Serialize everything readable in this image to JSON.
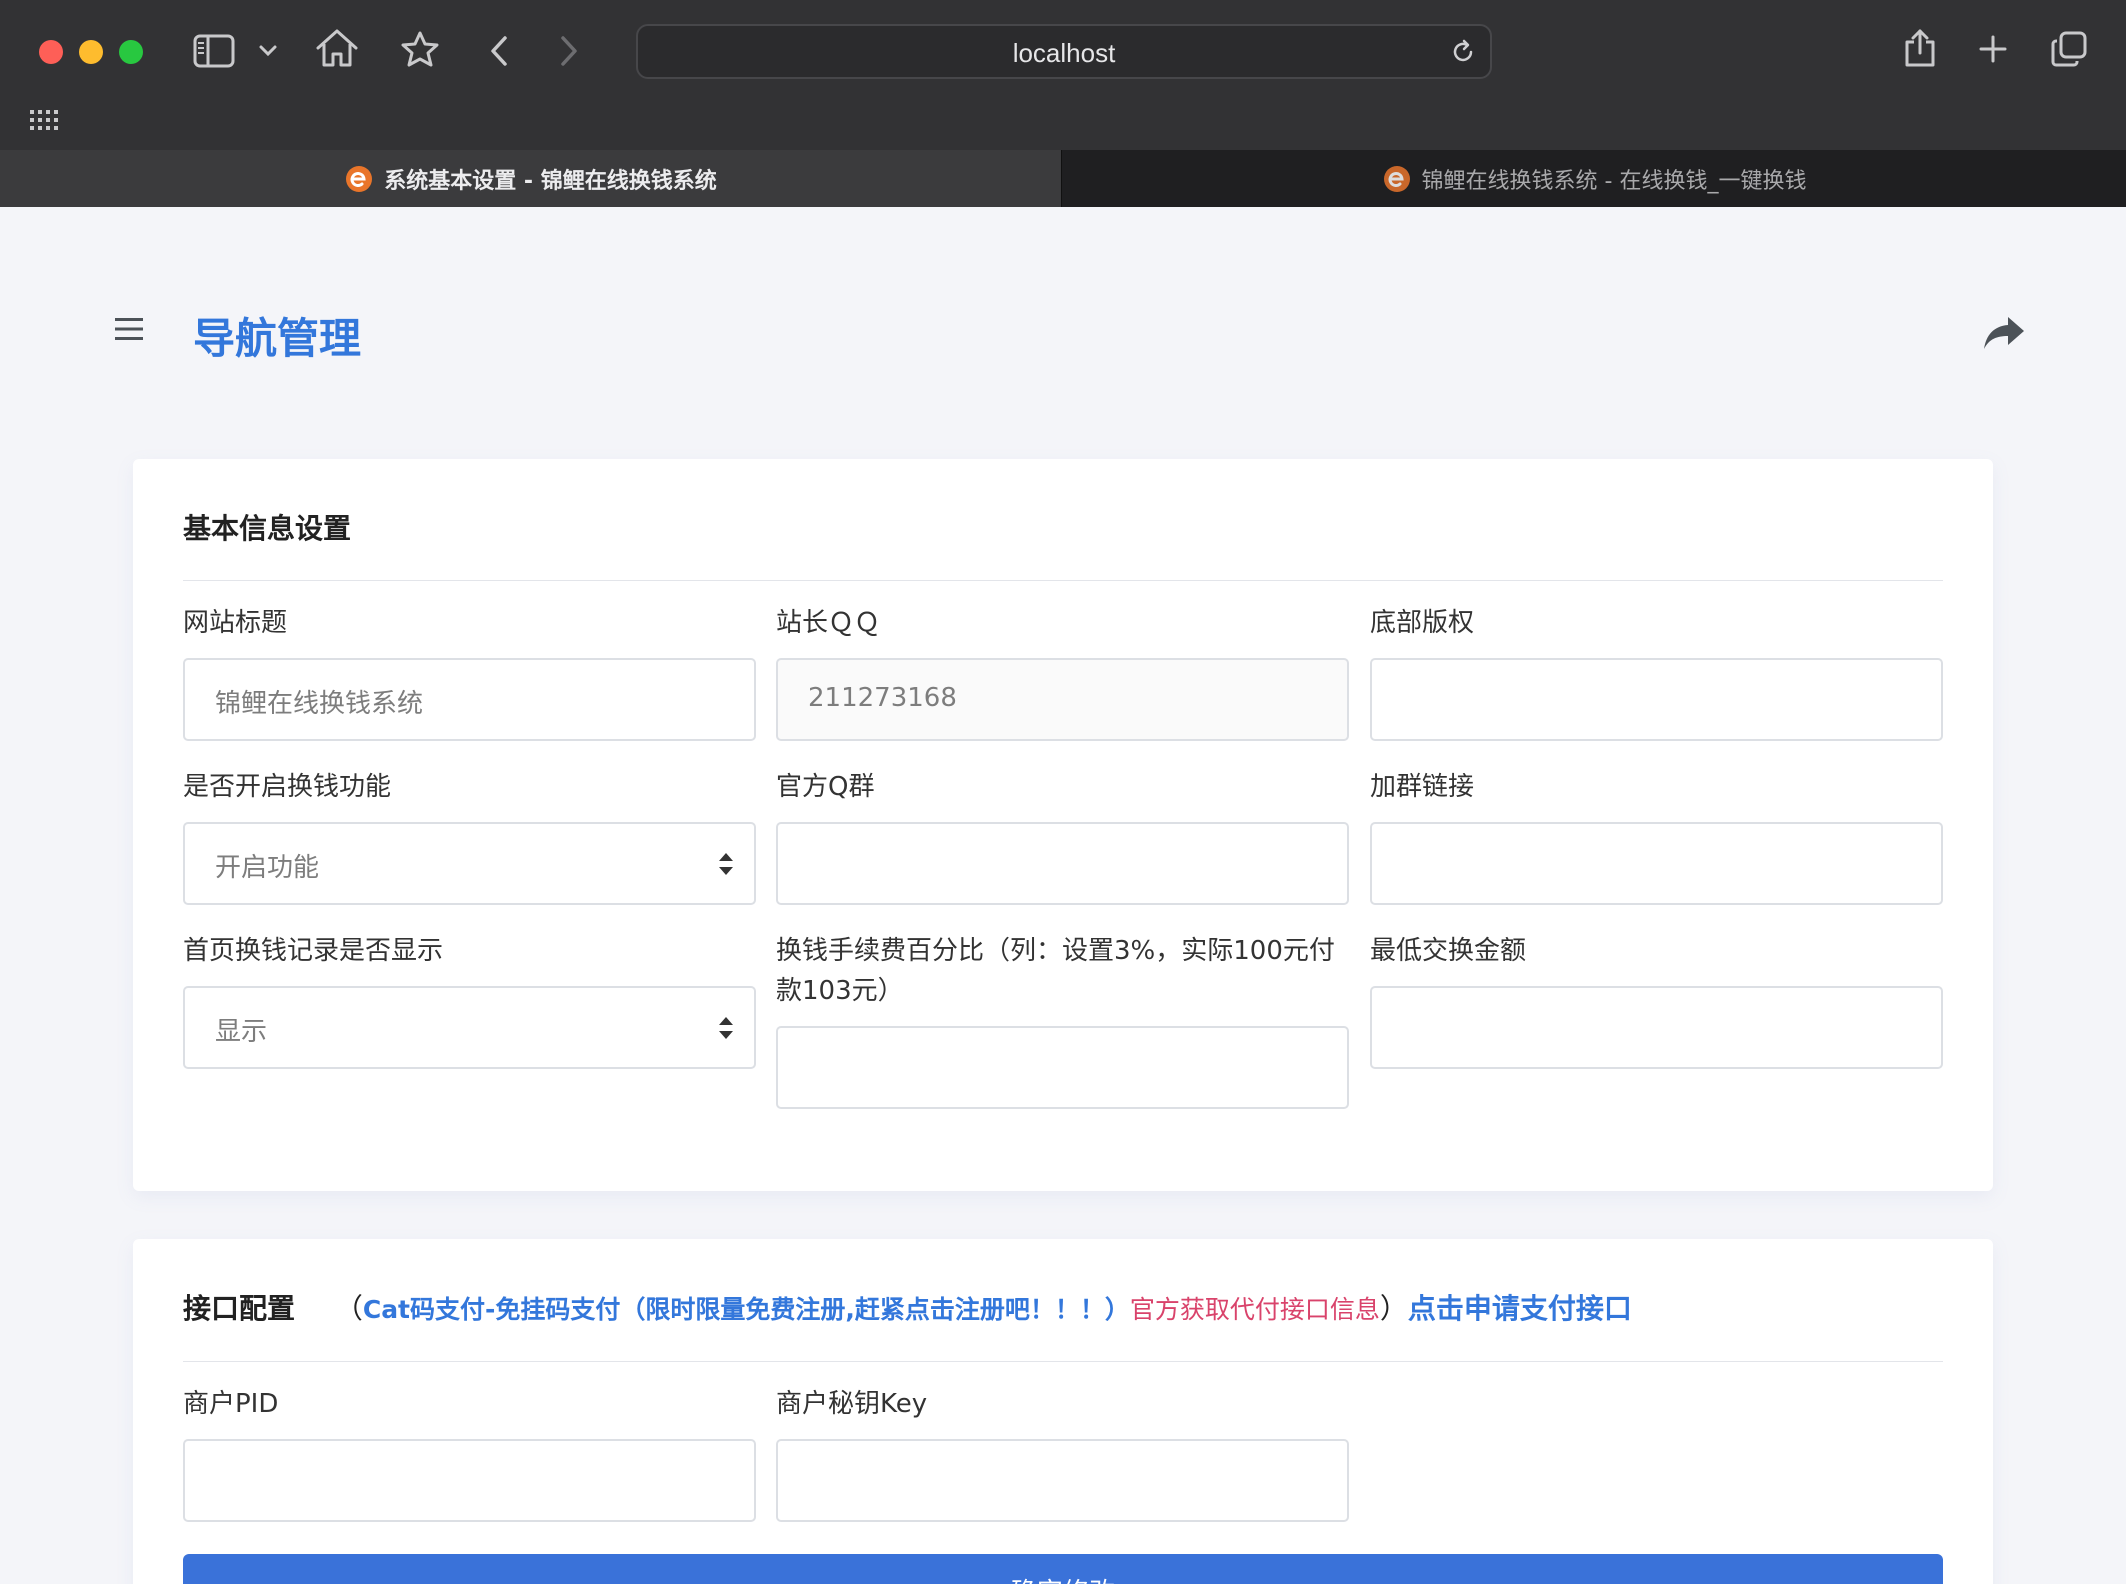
{
  "browser": {
    "address": "localhost",
    "tabs": [
      {
        "label": "系统基本设置 - 锦鲤在线换钱系统"
      },
      {
        "label": "锦鲤在线换钱系统 - 在线换钱_一键换钱"
      }
    ]
  },
  "page": {
    "title": "导航管理"
  },
  "basic_settings": {
    "title": "基本信息设置",
    "fields": {
      "site_title": {
        "label": "网站标题",
        "value": "锦鲤在线换钱系统"
      },
      "owner_qq": {
        "label": "站长ＱＱ",
        "value": "211273168"
      },
      "footer_copyright": {
        "label": "底部版权",
        "value": ""
      },
      "exchange_enabled": {
        "label": "是否开启换钱功能",
        "value": "开启功能"
      },
      "official_group": {
        "label": "官方Q群",
        "value": ""
      },
      "group_link": {
        "label": "加群链接",
        "value": ""
      },
      "home_records": {
        "label": "首页换钱记录是否显示",
        "value": "显示"
      },
      "fee_percent": {
        "label": "换钱手续费百分比（列：设置3%，实际100元付款103元）",
        "value": ""
      },
      "min_amount": {
        "label": "最低交换金额",
        "value": ""
      }
    }
  },
  "api_settings": {
    "title": "接口配置",
    "paren_open": "（",
    "cat_link": "Cat码支付-免挂码支付（限时限量免费注册,赶紧点击注册吧！！！）",
    "official_text": "官方获取代付接口信息",
    "paren_close": "）",
    "apply_link": "点击申请支付接口",
    "fields": {
      "merchant_pid": {
        "label": "商户PID",
        "value": ""
      },
      "merchant_key": {
        "label": "商户秘钥Key",
        "value": ""
      }
    }
  },
  "submit": {
    "label": "确定修改"
  },
  "colors": {
    "accent": "#3377db",
    "link_red": "#d9436b",
    "button": "#3a72d9"
  }
}
